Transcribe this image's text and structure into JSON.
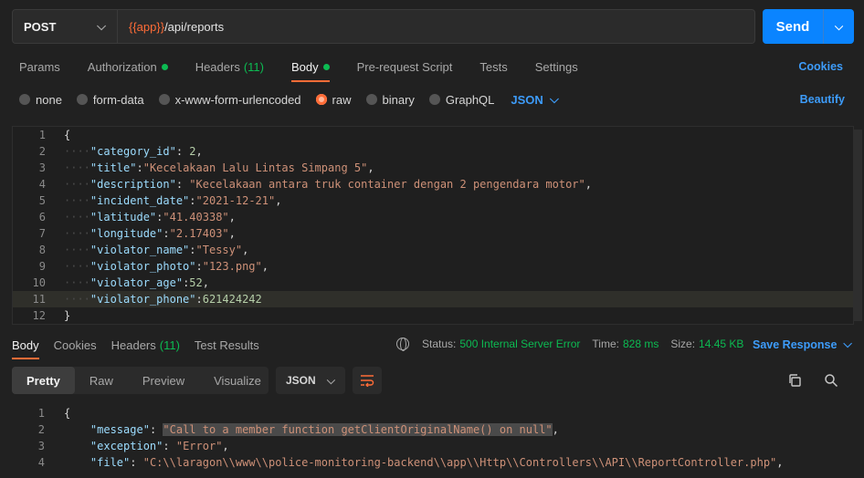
{
  "request": {
    "method": "POST",
    "url_var": "{{app}}",
    "url_path": "/api/reports",
    "send_label": "Send"
  },
  "req_tabs": [
    {
      "label": "Params"
    },
    {
      "label": "Authorization"
    },
    {
      "label": "Headers",
      "count": "(11)"
    },
    {
      "label": "Body"
    },
    {
      "label": "Pre-request Script"
    },
    {
      "label": "Tests"
    },
    {
      "label": "Settings"
    }
  ],
  "cookies_label": "Cookies",
  "body_types": [
    {
      "label": "none"
    },
    {
      "label": "form-data"
    },
    {
      "label": "x-www-form-urlencoded"
    },
    {
      "label": "raw"
    },
    {
      "label": "binary"
    },
    {
      "label": "GraphQL"
    }
  ],
  "body_format": "JSON",
  "beautify_label": "Beautify",
  "request_body": [
    {
      "n": "1",
      "open": "{"
    },
    {
      "n": "2",
      "key": "\"category_id\"",
      "sep": ": ",
      "val": "2",
      "type": "num",
      "end": ","
    },
    {
      "n": "3",
      "key": "\"title\"",
      "sep": ":",
      "val": "\"Kecelakaan Lalu Lintas Simpang 5\"",
      "type": "str",
      "end": ","
    },
    {
      "n": "4",
      "key": "\"description\"",
      "sep": ": ",
      "val": "\"Kecelakaan antara truk container dengan 2 pengendara motor\"",
      "type": "str",
      "end": ","
    },
    {
      "n": "5",
      "key": "\"incident_date\"",
      "sep": ":",
      "val": "\"2021-12-21\"",
      "type": "str",
      "end": ","
    },
    {
      "n": "6",
      "key": "\"latitude\"",
      "sep": ":",
      "val": "\"41.40338\"",
      "type": "str",
      "end": ","
    },
    {
      "n": "7",
      "key": "\"longitude\"",
      "sep": ":",
      "val": "\"2.17403\"",
      "type": "str",
      "end": ","
    },
    {
      "n": "8",
      "key": "\"violator_name\"",
      "sep": ":",
      "val": "\"Tessy\"",
      "type": "str",
      "end": ","
    },
    {
      "n": "9",
      "key": "\"violator_photo\"",
      "sep": ":",
      "val": "\"123.png\"",
      "type": "str",
      "end": ","
    },
    {
      "n": "10",
      "key": "\"violator_age\"",
      "sep": ":",
      "val": "52",
      "type": "num",
      "end": ","
    },
    {
      "n": "11",
      "key": "\"violator_phone\"",
      "sep": ":",
      "val": "621424242",
      "type": "num",
      "end": ""
    },
    {
      "n": "12",
      "open": "}"
    }
  ],
  "resp_tabs": [
    {
      "label": "Body"
    },
    {
      "label": "Cookies"
    },
    {
      "label": "Headers",
      "count": "(11)"
    },
    {
      "label": "Test Results"
    }
  ],
  "status": {
    "status_label": "Status:",
    "status_value": "500 Internal Server Error",
    "time_label": "Time:",
    "time_value": "828 ms",
    "size_label": "Size:",
    "size_value": "14.45 KB"
  },
  "save_response_label": "Save Response",
  "view_modes": [
    "Pretty",
    "Raw",
    "Preview",
    "Visualize"
  ],
  "resp_format": "JSON",
  "response_body": [
    {
      "n": "1",
      "open": "{"
    },
    {
      "n": "2",
      "key": "\"message\"",
      "sep": ": ",
      "val": "\"Call to a member function getClientOriginalName() on null\"",
      "type": "str",
      "end": ","
    },
    {
      "n": "3",
      "key": "\"exception\"",
      "sep": ": ",
      "val": "\"Error\"",
      "type": "str",
      "end": ","
    },
    {
      "n": "4",
      "key": "\"file\"",
      "sep": ": ",
      "val": "\"C:\\\\laragon\\\\www\\\\police-monitoring-backend\\\\app\\\\Http\\\\Controllers\\\\API\\\\ReportController.php\"",
      "type": "str",
      "end": ","
    }
  ],
  "colors": {
    "accent": "#ff6c37",
    "link": "#3d9cfa",
    "send": "#0a84ff",
    "success": "#0cbb52"
  }
}
